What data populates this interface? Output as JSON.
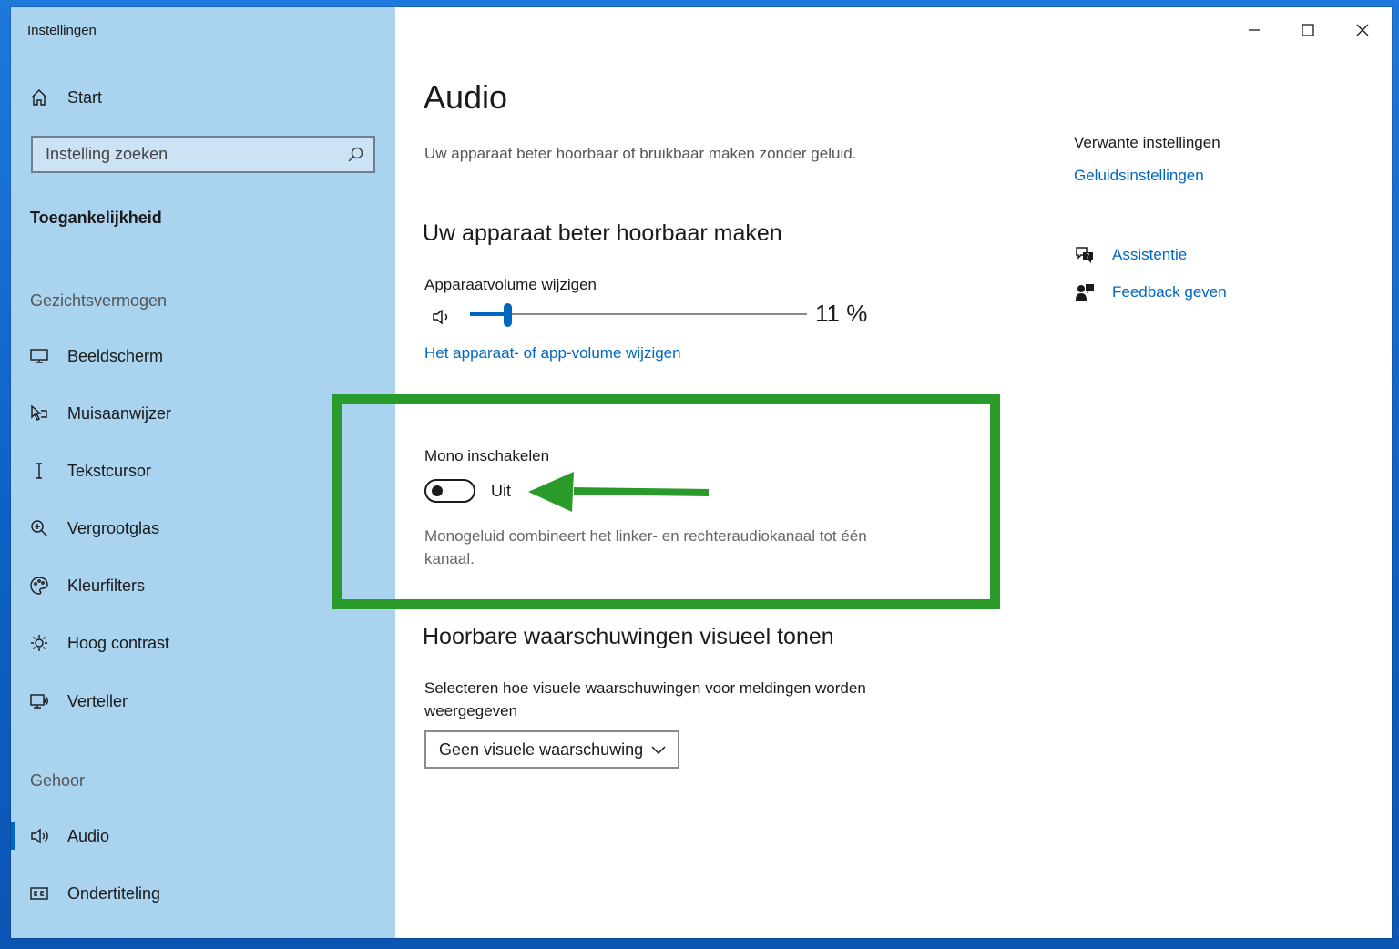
{
  "window": {
    "title": "Instellingen"
  },
  "sidebar": {
    "home_label": "Start",
    "search_placeholder": "Instelling zoeken",
    "section_title": "Toegankelijkheid",
    "groups": [
      {
        "label": "Gezichtsvermogen",
        "items": [
          {
            "label": "Beeldscherm",
            "icon": "monitor-icon"
          },
          {
            "label": "Muisaanwijzer",
            "icon": "mouse-pointer-icon"
          },
          {
            "label": "Tekstcursor",
            "icon": "text-cursor-icon"
          },
          {
            "label": "Vergrootglas",
            "icon": "magnifier-icon"
          },
          {
            "label": "Kleurfilters",
            "icon": "palette-icon"
          },
          {
            "label": "Hoog contrast",
            "icon": "brightness-icon"
          },
          {
            "label": "Verteller",
            "icon": "narrator-icon"
          }
        ]
      },
      {
        "label": "Gehoor",
        "items": [
          {
            "label": "Audio",
            "icon": "speaker-icon",
            "active": true
          },
          {
            "label": "Ondertiteling",
            "icon": "closed-captions-icon"
          }
        ]
      }
    ]
  },
  "main": {
    "title": "Audio",
    "description": "Uw apparaat beter hoorbaar of bruikbaar maken zonder geluid.",
    "section1": {
      "heading": "Uw apparaat beter hoorbaar maken",
      "volume_label": "Apparaatvolume wijzigen",
      "volume_percent": 11,
      "volume_text": "11 %",
      "volume_link": "Het apparaat- of app-volume wijzigen",
      "mono_label": "Mono inschakelen",
      "mono_state": "Uit",
      "mono_on": false,
      "mono_description_1": "Monogeluid combineert het linker- en rechteraudiokanaal tot één",
      "mono_description_2": "kanaal."
    },
    "section2": {
      "heading": "Hoorbare waarschuwingen visueel tonen",
      "select_label_1": "Selecteren hoe visuele waarschuwingen voor meldingen worden",
      "select_label_2": "weergegeven",
      "dropdown_value": "Geen visuele waarschuwing"
    }
  },
  "related": {
    "title": "Verwante instellingen",
    "link": "Geluidsinstellingen",
    "help": [
      {
        "label": "Assistentie",
        "icon": "help-chat-icon"
      },
      {
        "label": "Feedback geven",
        "icon": "feedback-icon"
      }
    ]
  },
  "colors": {
    "accent": "#0067c0",
    "sidebar": "#a9d3ef",
    "highlight": "#2a9a2a"
  }
}
